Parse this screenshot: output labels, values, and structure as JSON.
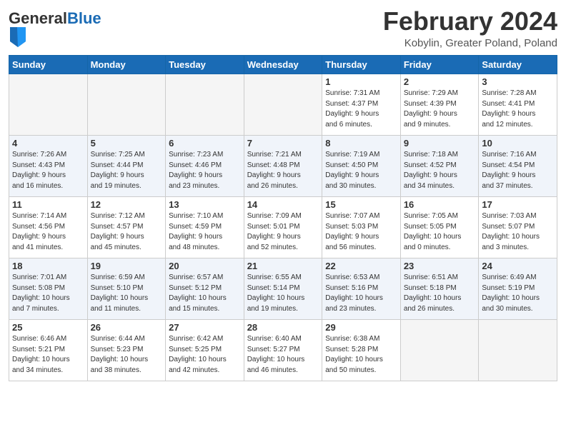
{
  "header": {
    "logo_general": "General",
    "logo_blue": "Blue",
    "title": "February 2024",
    "subtitle": "Kobylin, Greater Poland, Poland"
  },
  "weekdays": [
    "Sunday",
    "Monday",
    "Tuesday",
    "Wednesday",
    "Thursday",
    "Friday",
    "Saturday"
  ],
  "weeks": [
    [
      {
        "day": "",
        "info": "",
        "empty": true
      },
      {
        "day": "",
        "info": "",
        "empty": true
      },
      {
        "day": "",
        "info": "",
        "empty": true
      },
      {
        "day": "",
        "info": "",
        "empty": true
      },
      {
        "day": "1",
        "info": "Sunrise: 7:31 AM\nSunset: 4:37 PM\nDaylight: 9 hours\nand 6 minutes."
      },
      {
        "day": "2",
        "info": "Sunrise: 7:29 AM\nSunset: 4:39 PM\nDaylight: 9 hours\nand 9 minutes."
      },
      {
        "day": "3",
        "info": "Sunrise: 7:28 AM\nSunset: 4:41 PM\nDaylight: 9 hours\nand 12 minutes."
      }
    ],
    [
      {
        "day": "4",
        "info": "Sunrise: 7:26 AM\nSunset: 4:43 PM\nDaylight: 9 hours\nand 16 minutes."
      },
      {
        "day": "5",
        "info": "Sunrise: 7:25 AM\nSunset: 4:44 PM\nDaylight: 9 hours\nand 19 minutes."
      },
      {
        "day": "6",
        "info": "Sunrise: 7:23 AM\nSunset: 4:46 PM\nDaylight: 9 hours\nand 23 minutes."
      },
      {
        "day": "7",
        "info": "Sunrise: 7:21 AM\nSunset: 4:48 PM\nDaylight: 9 hours\nand 26 minutes."
      },
      {
        "day": "8",
        "info": "Sunrise: 7:19 AM\nSunset: 4:50 PM\nDaylight: 9 hours\nand 30 minutes."
      },
      {
        "day": "9",
        "info": "Sunrise: 7:18 AM\nSunset: 4:52 PM\nDaylight: 9 hours\nand 34 minutes."
      },
      {
        "day": "10",
        "info": "Sunrise: 7:16 AM\nSunset: 4:54 PM\nDaylight: 9 hours\nand 37 minutes."
      }
    ],
    [
      {
        "day": "11",
        "info": "Sunrise: 7:14 AM\nSunset: 4:56 PM\nDaylight: 9 hours\nand 41 minutes."
      },
      {
        "day": "12",
        "info": "Sunrise: 7:12 AM\nSunset: 4:57 PM\nDaylight: 9 hours\nand 45 minutes."
      },
      {
        "day": "13",
        "info": "Sunrise: 7:10 AM\nSunset: 4:59 PM\nDaylight: 9 hours\nand 48 minutes."
      },
      {
        "day": "14",
        "info": "Sunrise: 7:09 AM\nSunset: 5:01 PM\nDaylight: 9 hours\nand 52 minutes."
      },
      {
        "day": "15",
        "info": "Sunrise: 7:07 AM\nSunset: 5:03 PM\nDaylight: 9 hours\nand 56 minutes."
      },
      {
        "day": "16",
        "info": "Sunrise: 7:05 AM\nSunset: 5:05 PM\nDaylight: 10 hours\nand 0 minutes."
      },
      {
        "day": "17",
        "info": "Sunrise: 7:03 AM\nSunset: 5:07 PM\nDaylight: 10 hours\nand 3 minutes."
      }
    ],
    [
      {
        "day": "18",
        "info": "Sunrise: 7:01 AM\nSunset: 5:08 PM\nDaylight: 10 hours\nand 7 minutes."
      },
      {
        "day": "19",
        "info": "Sunrise: 6:59 AM\nSunset: 5:10 PM\nDaylight: 10 hours\nand 11 minutes."
      },
      {
        "day": "20",
        "info": "Sunrise: 6:57 AM\nSunset: 5:12 PM\nDaylight: 10 hours\nand 15 minutes."
      },
      {
        "day": "21",
        "info": "Sunrise: 6:55 AM\nSunset: 5:14 PM\nDaylight: 10 hours\nand 19 minutes."
      },
      {
        "day": "22",
        "info": "Sunrise: 6:53 AM\nSunset: 5:16 PM\nDaylight: 10 hours\nand 23 minutes."
      },
      {
        "day": "23",
        "info": "Sunrise: 6:51 AM\nSunset: 5:18 PM\nDaylight: 10 hours\nand 26 minutes."
      },
      {
        "day": "24",
        "info": "Sunrise: 6:49 AM\nSunset: 5:19 PM\nDaylight: 10 hours\nand 30 minutes."
      }
    ],
    [
      {
        "day": "25",
        "info": "Sunrise: 6:46 AM\nSunset: 5:21 PM\nDaylight: 10 hours\nand 34 minutes."
      },
      {
        "day": "26",
        "info": "Sunrise: 6:44 AM\nSunset: 5:23 PM\nDaylight: 10 hours\nand 38 minutes."
      },
      {
        "day": "27",
        "info": "Sunrise: 6:42 AM\nSunset: 5:25 PM\nDaylight: 10 hours\nand 42 minutes."
      },
      {
        "day": "28",
        "info": "Sunrise: 6:40 AM\nSunset: 5:27 PM\nDaylight: 10 hours\nand 46 minutes."
      },
      {
        "day": "29",
        "info": "Sunrise: 6:38 AM\nSunset: 5:28 PM\nDaylight: 10 hours\nand 50 minutes."
      },
      {
        "day": "",
        "info": "",
        "empty": true
      },
      {
        "day": "",
        "info": "",
        "empty": true
      }
    ]
  ]
}
